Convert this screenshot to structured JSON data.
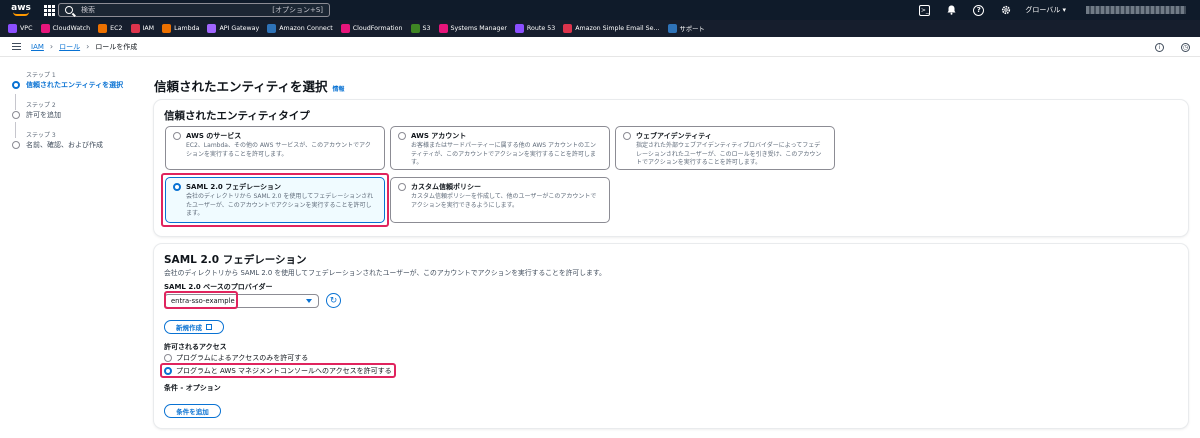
{
  "topnav": {
    "logo_text": "aws",
    "search_placeholder": "検索",
    "search_hint": "[オプション+S]",
    "region": "グローバル ▾"
  },
  "favorites": [
    {
      "label": "VPC",
      "color": "#8c4fff"
    },
    {
      "label": "CloudWatch",
      "color": "#e7157b"
    },
    {
      "label": "EC2",
      "color": "#ed7100"
    },
    {
      "label": "IAM",
      "color": "#dd344c"
    },
    {
      "label": "Lambda",
      "color": "#ed7100"
    },
    {
      "label": "API Gateway",
      "color": "#a166ff"
    },
    {
      "label": "Amazon Connect",
      "color": "#2e73b8"
    },
    {
      "label": "CloudFormation",
      "color": "#e7157b"
    },
    {
      "label": "S3",
      "color": "#3f8624"
    },
    {
      "label": "Systems Manager",
      "color": "#e7157b"
    },
    {
      "label": "Route 53",
      "color": "#8c4fff"
    },
    {
      "label": "Amazon Simple Email Se...",
      "color": "#dd344c"
    },
    {
      "label": "サポート",
      "color": "#2e73b8"
    }
  ],
  "breadcrumb": {
    "iam": "IAM",
    "roles": "ロール",
    "current": "ロールを作成"
  },
  "steps": [
    {
      "no": "ステップ 1",
      "name": "信頼されたエンティティを選択"
    },
    {
      "no": "ステップ 2",
      "name": "許可を追加"
    },
    {
      "no": "ステップ 3",
      "name": "名前、確認、および作成"
    }
  ],
  "page": {
    "title": "信頼されたエンティティを選択",
    "info": "情報"
  },
  "entity_type": {
    "heading": "信頼されたエンティティタイプ",
    "tiles": [
      {
        "title": "AWS のサービス",
        "desc": "EC2、Lambda、その他の AWS サービスが、このアカウントでアクションを実行することを許可します。"
      },
      {
        "title": "AWS アカウント",
        "desc": "お客様またはサードパーティーに属する他の AWS アカウントのエンティティが、このアカウントでアクションを実行することを許可します。"
      },
      {
        "title": "ウェブアイデンティティ",
        "desc": "指定された外部ウェブアイデンティティプロバイダーによってフェデレーションされたユーザーが、このロールを引き受け、このアカウントでアクションを実行することを許可します。"
      },
      {
        "title": "SAML 2.0 フェデレーション",
        "desc": "会社のディレクトリから SAML 2.0 を使用してフェデレーションされたユーザーが、このアカウントでアクションを実行することを許可します。"
      },
      {
        "title": "カスタム信頼ポリシー",
        "desc": "カスタム信頼ポリシーを作成して、他のユーザーがこのアカウントでアクションを実行できるようにします。"
      }
    ],
    "selected_index": 3
  },
  "saml": {
    "heading": "SAML 2.0 フェデレーション",
    "description": "会社のディレクトリから SAML 2.0 を使用してフェデレーションされたユーザーが、このアカウントでアクションを実行することを許可します。",
    "provider_label": "SAML 2.0 ベースのプロバイダー",
    "provider_value": "entra-sso-example",
    "create_button": "新規作成",
    "access_label": "許可されるアクセス",
    "access_options": [
      "プログラムによるアクセスのみを許可する",
      "プログラムと AWS マネジメントコンソールへのアクセスを許可する"
    ],
    "access_selected_index": 1,
    "conditions_label": "条件 - オプション",
    "add_condition_button": "条件を追加"
  },
  "colors": {
    "accent": "#0972d3",
    "highlight": "#e0245e",
    "nav_bg": "#0f1b2a"
  }
}
